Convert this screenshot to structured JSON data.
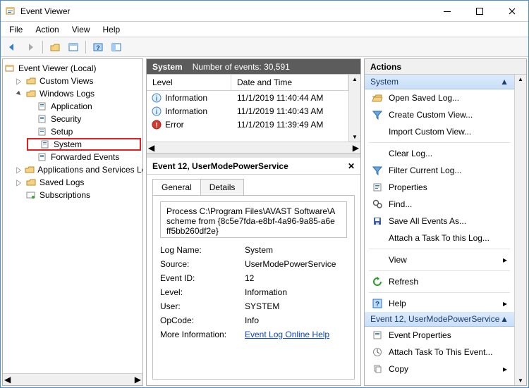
{
  "window": {
    "title": "Event Viewer"
  },
  "menu": [
    "File",
    "Action",
    "View",
    "Help"
  ],
  "tree": {
    "root": "Event Viewer (Local)",
    "custom_views": "Custom Views",
    "windows_logs": "Windows Logs",
    "wl": {
      "application": "Application",
      "security": "Security",
      "setup": "Setup",
      "system": "System",
      "forwarded": "Forwarded Events"
    },
    "apps_services": "Applications and Services Lo",
    "saved_logs": "Saved Logs",
    "subscriptions": "Subscriptions"
  },
  "mid": {
    "header_title": "System",
    "header_count_label": "Number of events:",
    "header_count_value": "30,591",
    "cols": {
      "level": "Level",
      "datetime": "Date and Time"
    },
    "rows": [
      {
        "level": "Information",
        "datetime": "11/1/2019 11:40:44 AM",
        "icon": "info"
      },
      {
        "level": "Information",
        "datetime": "11/1/2019 11:40:43 AM",
        "icon": "info"
      },
      {
        "level": "Error",
        "datetime": "11/1/2019 11:39:49 AM",
        "icon": "error"
      }
    ],
    "detail_title": "Event 12, UserModePowerService",
    "tabs": {
      "general": "General",
      "details": "Details"
    },
    "message": "Process C:\\Program Files\\AVAST Software\\A scheme from {8c5e7fda-e8bf-4a96-9a85-a6e ff5bb260df2e}",
    "kv": {
      "log_name_k": "Log Name:",
      "log_name_v": "System",
      "source_k": "Source:",
      "source_v": "UserModePowerService",
      "eventid_k": "Event ID:",
      "eventid_v": "12",
      "level_k": "Level:",
      "level_v": "Information",
      "user_k": "User:",
      "user_v": "SYSTEM",
      "opcode_k": "OpCode:",
      "opcode_v": "Info",
      "more_k": "More Information:",
      "more_v": "Event Log Online Help"
    }
  },
  "actions": {
    "title": "Actions",
    "group1_title": "System",
    "items1": [
      "Open Saved Log...",
      "Create Custom View...",
      "Import Custom View...",
      "Clear Log...",
      "Filter Current Log...",
      "Properties",
      "Find...",
      "Save All Events As...",
      "Attach a Task To this Log...",
      "View",
      "Refresh",
      "Help"
    ],
    "group2_title": "Event 12, UserModePowerService",
    "items2": [
      "Event Properties",
      "Attach Task To This Event...",
      "Copy"
    ]
  }
}
